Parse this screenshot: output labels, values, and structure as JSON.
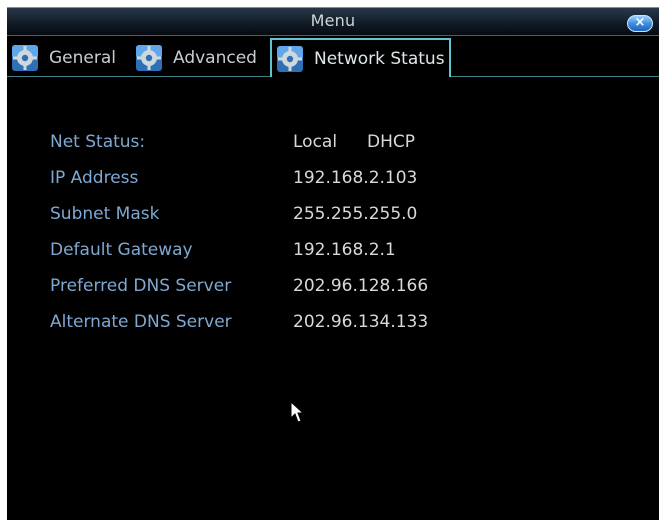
{
  "window": {
    "title": "Menu",
    "close_label": "×"
  },
  "tabs": [
    {
      "label": "General",
      "icon": "gear-icon"
    },
    {
      "label": "Advanced",
      "icon": "gear-icon"
    },
    {
      "label": "Network Status",
      "icon": "gear-icon",
      "active": true
    }
  ],
  "network": {
    "net_status": {
      "label": "Net Status:",
      "value_1": "Local",
      "value_2": "DHCP"
    },
    "ip_address": {
      "label": "IP Address",
      "value": "192.168.2.103"
    },
    "subnet_mask": {
      "label": "Subnet Mask",
      "value": "255.255.255.0"
    },
    "default_gateway": {
      "label": "Default Gateway",
      "value": "192.168.2.1"
    },
    "preferred_dns": {
      "label": "Preferred DNS Server",
      "value": "202.96.128.166"
    },
    "alternate_dns": {
      "label": "Alternate DNS Server",
      "value": "202.96.134.133"
    }
  },
  "colors": {
    "background": "#000000",
    "label": "#7fa8d2",
    "value": "#d7d9db",
    "active_tab_border": "#5fc4cf"
  }
}
